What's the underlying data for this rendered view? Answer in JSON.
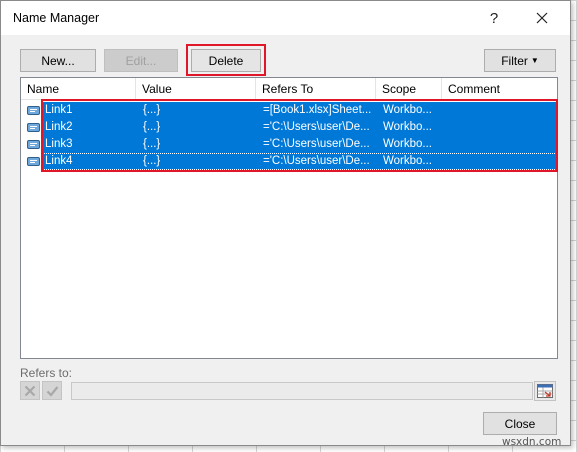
{
  "window": {
    "title": "Name Manager",
    "help_label": "?",
    "close_label": "×"
  },
  "toolbar": {
    "new_label": "New...",
    "edit_label": "Edit...",
    "delete_label": "Delete",
    "filter_label": "Filter"
  },
  "table": {
    "columns": [
      "Name",
      "Value",
      "Refers To",
      "Scope",
      "Comment"
    ],
    "rows": [
      {
        "name": "Link1",
        "value": "{...}",
        "refers_to": "=[Book1.xlsx]Sheet...",
        "scope": "Workbo...",
        "comment": ""
      },
      {
        "name": "Link2",
        "value": "{...}",
        "refers_to": "='C:\\Users\\user\\De...",
        "scope": "Workbo...",
        "comment": ""
      },
      {
        "name": "Link3",
        "value": "{...}",
        "refers_to": "='C:\\Users\\user\\De...",
        "scope": "Workbo...",
        "comment": ""
      },
      {
        "name": "Link4",
        "value": "{...}",
        "refers_to": "='C:\\Users\\user\\De...",
        "scope": "Workbo...",
        "comment": ""
      }
    ]
  },
  "refers_to_panel": {
    "label": "Refers to:",
    "value": ""
  },
  "footer": {
    "close_label": "Close"
  },
  "watermark": "wsxdn.com",
  "colors": {
    "selection": "#0078d7",
    "highlight_outline": "#e0162b",
    "dialog_bg": "#f0f0f0"
  },
  "icons": [
    "name-tag-icon",
    "cancel-x-icon",
    "confirm-check-icon",
    "range-select-icon",
    "close-x-icon",
    "dropdown-caret-icon"
  ]
}
